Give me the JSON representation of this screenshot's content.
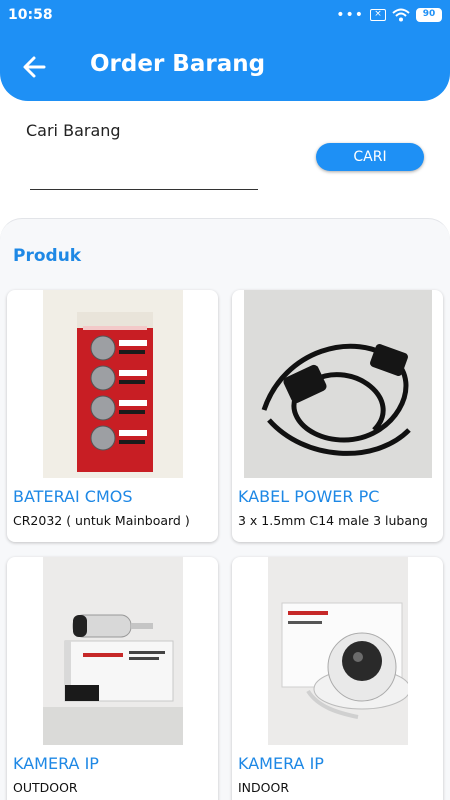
{
  "status_bar": {
    "time": "10:58",
    "battery": "90"
  },
  "header": {
    "title": "Order Barang"
  },
  "search": {
    "label": "Cari Barang",
    "placeholder": "",
    "value": "",
    "button": "CARI"
  },
  "section_title": "Produk",
  "products": [
    {
      "name": "BATERAI CMOS",
      "desc": "CR2032 ( untuk Mainboard )",
      "icon": "battery-photo"
    },
    {
      "name": "KABEL POWER PC",
      "desc": "3 x 1.5mm C14 male 3 lubang",
      "icon": "power-cable-photo"
    },
    {
      "name": "KAMERA IP",
      "desc": "OUTDOOR",
      "icon": "bullet-camera-photo"
    },
    {
      "name": "KAMERA IP",
      "desc": "INDOOR",
      "icon": "dome-camera-photo"
    }
  ],
  "colors": {
    "primary": "#1e90f5",
    "accent_text": "#1e88e5",
    "panel_bg": "#f7f8fa"
  }
}
